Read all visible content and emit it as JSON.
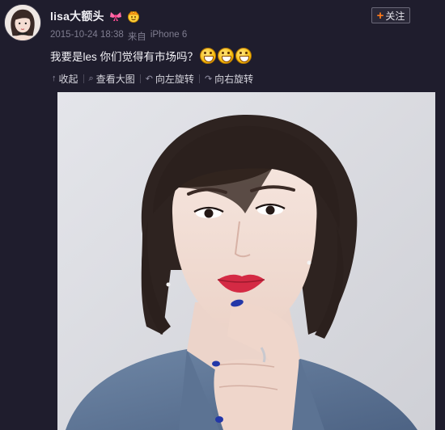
{
  "user": {
    "name": "lisa大额头",
    "badge_icons": [
      "bow-icon",
      "crown-icon"
    ]
  },
  "follow_button": {
    "label": "关注"
  },
  "meta": {
    "date": "2015-10-24 18:38",
    "source_prefix": "来自",
    "source_device": "iPhone 6"
  },
  "post": {
    "text": "我要是les 你们觉得有市场吗？",
    "emoji_count": 3,
    "emoji_name": "grin-emoji"
  },
  "toolbar": {
    "collapse": "收起",
    "view_large": "查看大图",
    "rotate_left": "向左旋转",
    "rotate_right": "向右旋转"
  },
  "colors": {
    "background": "#1f1d2d",
    "follow_plus": "#ff7a1a",
    "meta_text": "#7f7d90"
  }
}
